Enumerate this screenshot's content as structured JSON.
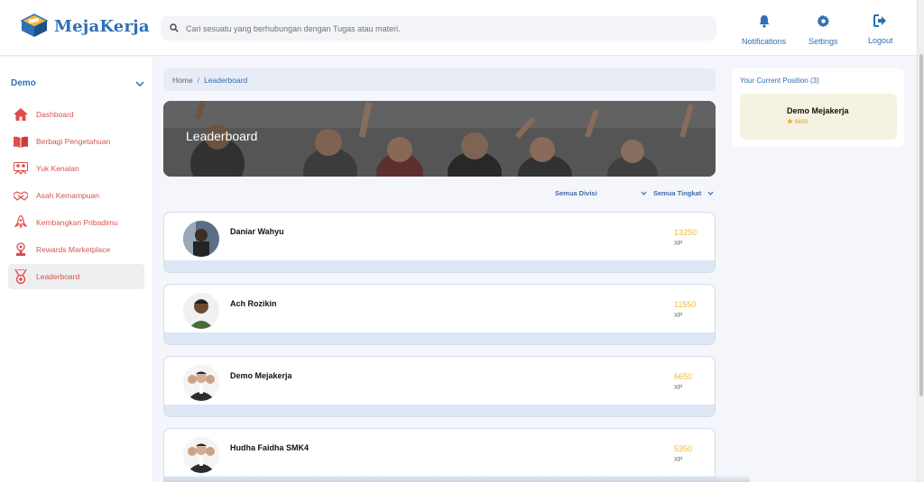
{
  "brand": {
    "name": "MejaKerja"
  },
  "search": {
    "placeholder": "Cari sesuatu yang berhubungan dengan Tugas atau materi."
  },
  "header": {
    "actions": [
      {
        "label": "Notifications",
        "icon": "bell-icon"
      },
      {
        "label": "Settings",
        "icon": "gear-icon"
      },
      {
        "label": "Logout",
        "icon": "logout-icon"
      }
    ]
  },
  "sidebar": {
    "org": "Demo",
    "items": [
      {
        "label": "Dashboard",
        "icon": "home-icon"
      },
      {
        "label": "Berbagi Pengetahuan",
        "icon": "book-icon"
      },
      {
        "label": "Yuk Kenalan",
        "icon": "people-icon"
      },
      {
        "label": "Asah Kemampuan",
        "icon": "handshake-icon"
      },
      {
        "label": "Kembangkan Pribadimu",
        "icon": "rocket-icon"
      },
      {
        "label": "Rewards Marketplace",
        "icon": "trophy-icon"
      },
      {
        "label": "Leaderboard",
        "icon": "medal-icon",
        "active": true
      }
    ]
  },
  "breadcrumb": {
    "home": "Home",
    "separator": "/",
    "current": "Leaderboard"
  },
  "banner": {
    "title": "Leaderboard"
  },
  "filters": {
    "division": "Semua Divisi",
    "level": "Semua Tingkat"
  },
  "leaderboard": [
    {
      "name": "Daniar Wahyu",
      "xp": "13250",
      "xp_label": "XP"
    },
    {
      "name": "Ach Rozikin",
      "xp": "11550",
      "xp_label": "XP"
    },
    {
      "name": "Demo Mejakerja",
      "xp": "6650",
      "xp_label": "XP"
    },
    {
      "name": "Hudha Faidha SMK4",
      "xp": "5350",
      "xp_label": "XP"
    }
  ],
  "current_position": {
    "title": "Your Current Position (3)",
    "name": "Demo Mejakerja",
    "xp": "6650"
  },
  "colors": {
    "brand_blue": "#2f6fb3",
    "menu_red": "#d9534f",
    "xp_gold": "#f1b93d"
  }
}
